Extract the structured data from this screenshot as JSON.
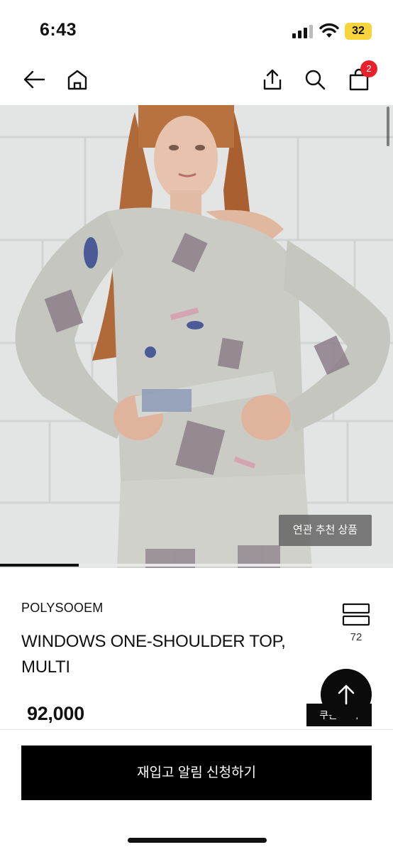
{
  "status_bar": {
    "time": "6:43",
    "battery": "32",
    "icons": [
      "signal-icon",
      "wifi-icon",
      "battery-icon"
    ]
  },
  "nav": {
    "icons": [
      "back-arrow-icon",
      "home-icon",
      "share-icon",
      "search-icon",
      "shopping-bag-icon"
    ],
    "cart_count": "2"
  },
  "gallery": {
    "related_button": "연관 추천 상품",
    "progress_fraction": 0.2
  },
  "product": {
    "brand": "POLYSOOEM",
    "name": "WINDOWS ONE-SHOULDER TOP, MULTI",
    "wish_count": "72",
    "price": "92,000",
    "coupon_label": "쿠폰 받기"
  },
  "bottom": {
    "restock_button": "재입고 알림 신청하기"
  },
  "colors": {
    "accent_badge": "#e8202b",
    "primary_button": "#000000",
    "battery": "#f7d43c"
  }
}
